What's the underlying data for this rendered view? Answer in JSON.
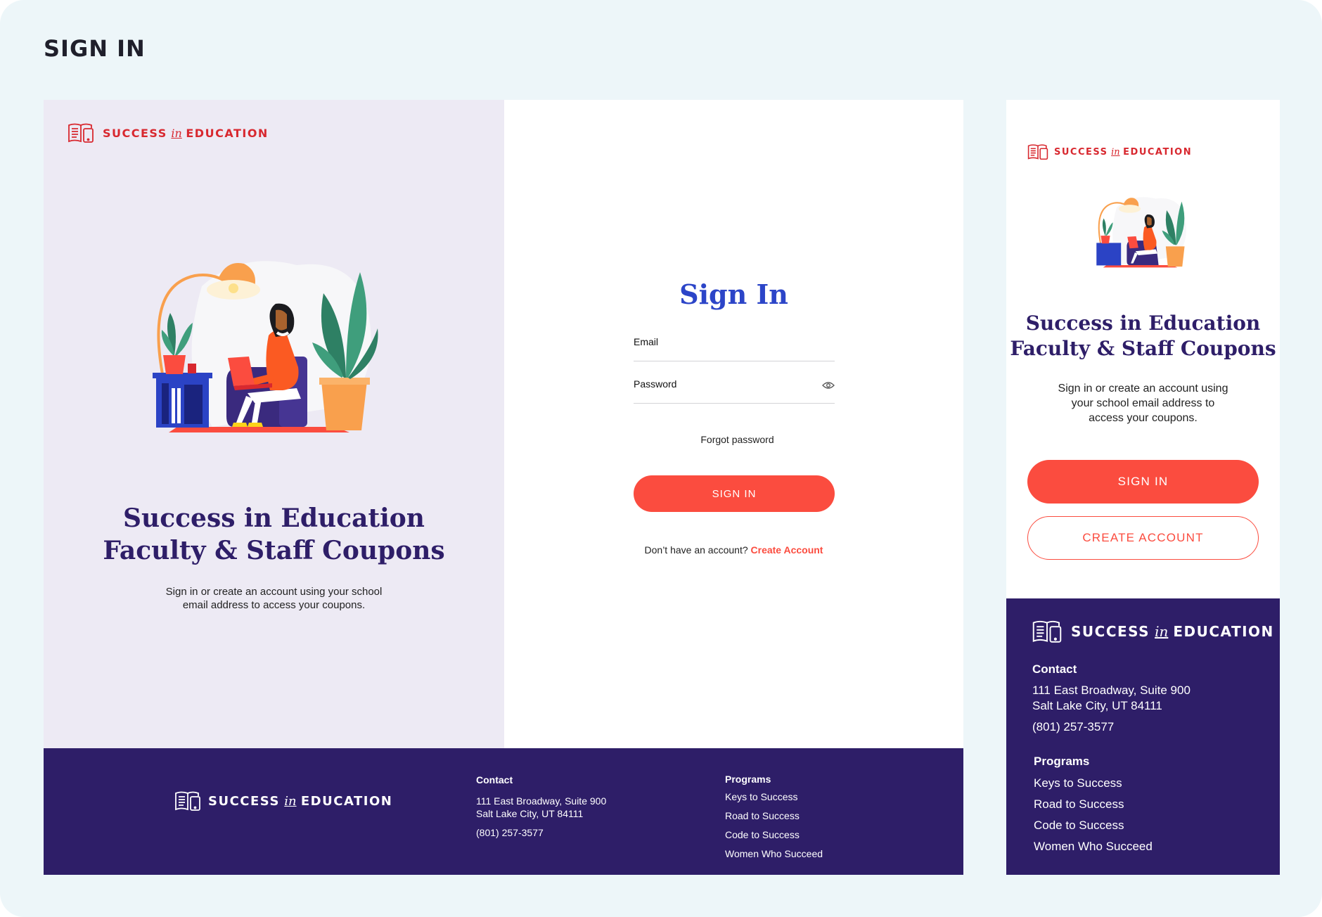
{
  "page": {
    "title": "SIGN IN"
  },
  "brand": {
    "pre": "SUCCESS",
    "mid": "in",
    "post": "EDUCATION"
  },
  "hero": {
    "heading_line1": "Success in Education",
    "heading_line2": "Faculty & Staff Coupons",
    "desktop_sub_line1": "Sign in or create an account using your school",
    "desktop_sub_line2": "email address to access your coupons.",
    "mobile_sub_line1": "Sign in or create an account using",
    "mobile_sub_line2": "your school email address to",
    "mobile_sub_line3": "access your coupons."
  },
  "form": {
    "title": "Sign In",
    "email_label": "Email",
    "password_label": "Password",
    "forgot_label": "Forgot password",
    "signin_button": "SIGN IN",
    "no_account_text": "Don’t have an account?",
    "create_account_link": "Create Account"
  },
  "mobile": {
    "signin_button": "SIGN IN",
    "create_account_button": "CREATE ACCOUNT"
  },
  "footer": {
    "contact_heading": "Contact",
    "address_line1": "111 East Broadway, Suite 900",
    "address_line2": "Salt Lake City, UT 84111",
    "phone": "(801) 257-3577",
    "programs_heading": "Programs",
    "programs": [
      "Keys to Success",
      "Road to Success",
      "Code to Success",
      "Women Who Succeed"
    ]
  },
  "colors": {
    "board": "#edf6f9",
    "brand_red": "#d8282f",
    "button_red": "#fb4c3f",
    "navy": "#2e1e68",
    "title_blue": "#2c45c8",
    "panel_lavender": "#edeaf4"
  },
  "icons": [
    "book-device-logo-icon",
    "eye-icon"
  ]
}
